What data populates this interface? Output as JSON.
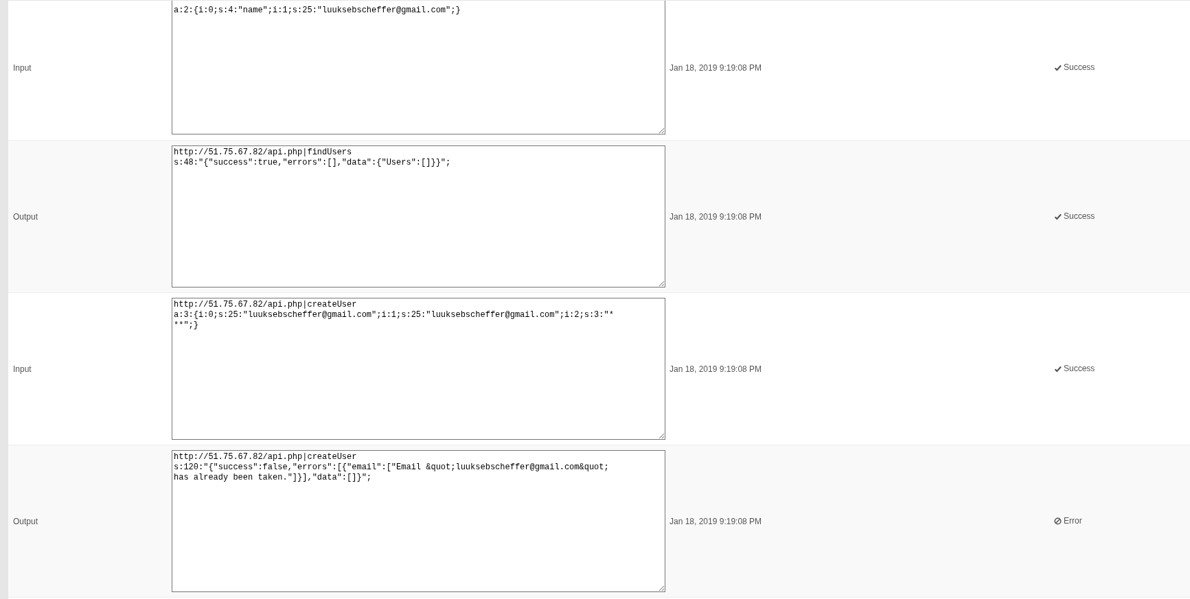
{
  "rows": [
    {
      "type": "Input",
      "payload": [
        "a:2:{i:0;s:4:\"name\";i:1;s:25:\"luuksebscheffer@gmail.com\";}"
      ],
      "date": "Jan 18, 2019 9:19:08 PM",
      "status": {
        "kind": "success",
        "label": "Success"
      }
    },
    {
      "type": "Output",
      "payload": [
        "http://51.75.67.82/api.php|findUsers",
        "s:48:\"{\"success\":true,\"errors\":[],\"data\":{\"Users\":[]}}\";"
      ],
      "date": "Jan 18, 2019 9:19:08 PM",
      "status": {
        "kind": "success",
        "label": "Success"
      }
    },
    {
      "type": "Input",
      "payload": [
        "http://51.75.67.82/api.php|createUser",
        "a:3:{i:0;s:25:\"luuksebscheffer@gmail.com\";i:1;s:25:\"luuksebscheffer@gmail.com\";i:2;s:3:\"*",
        "**\";}"
      ],
      "date": "Jan 18, 2019 9:19:08 PM",
      "status": {
        "kind": "success",
        "label": "Success"
      }
    },
    {
      "type": "Output",
      "payload": [
        "http://51.75.67.82/api.php|createUser",
        "s:120:\"{\"success\":false,\"errors\":[{\"email\":[\"Email &quot;luuksebscheffer@gmail.com&quot;",
        "has already been taken.\"]}],\"data\":[]}\";"
      ],
      "date": "Jan 18, 2019 9:19:08 PM",
      "status": {
        "kind": "error",
        "label": "Error"
      }
    }
  ]
}
